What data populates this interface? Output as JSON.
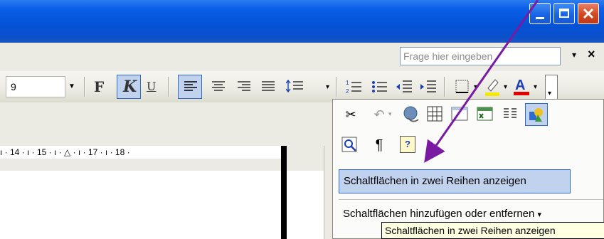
{
  "window": {
    "controls": [
      "minimize",
      "maximize",
      "close"
    ]
  },
  "help": {
    "ask_placeholder": "Frage hier eingeben",
    "close_glyph": "×",
    "dropdown_glyph": "▾"
  },
  "toolbar": {
    "font_size": "9",
    "bold_label": "F",
    "italic_label": "K",
    "underline_label": "U",
    "highlight_color": "#f5e800",
    "font_color": "#e00000",
    "overflow_glyph": "▾"
  },
  "ruler": {
    "ticks": "ı · 14 · ı · 15 · ı · △ · ı · 17 · ı · 18 ·"
  },
  "popup": {
    "menu_items": [
      "Schaltflächen in zwei Reihen anzeigen",
      "Schaltflächen hinzufügen oder entfernen"
    ],
    "add_remove_arrow": "▾"
  },
  "tooltip": {
    "text": "Schaltflächen in zwei Reihen anzeigen"
  },
  "colors": {
    "accent": "#316ac5",
    "annotation_arrow": "#7a1aa3"
  },
  "icons": {
    "row1": [
      "cut-icon",
      "undo-icon",
      "hyperlink-icon",
      "tables-icon",
      "insert-frame-icon",
      "excel-worksheet-icon",
      "columns-icon",
      "drawing-icon"
    ],
    "row2": [
      "document-map-icon",
      "pilcrow-icon",
      "help-icon"
    ]
  }
}
